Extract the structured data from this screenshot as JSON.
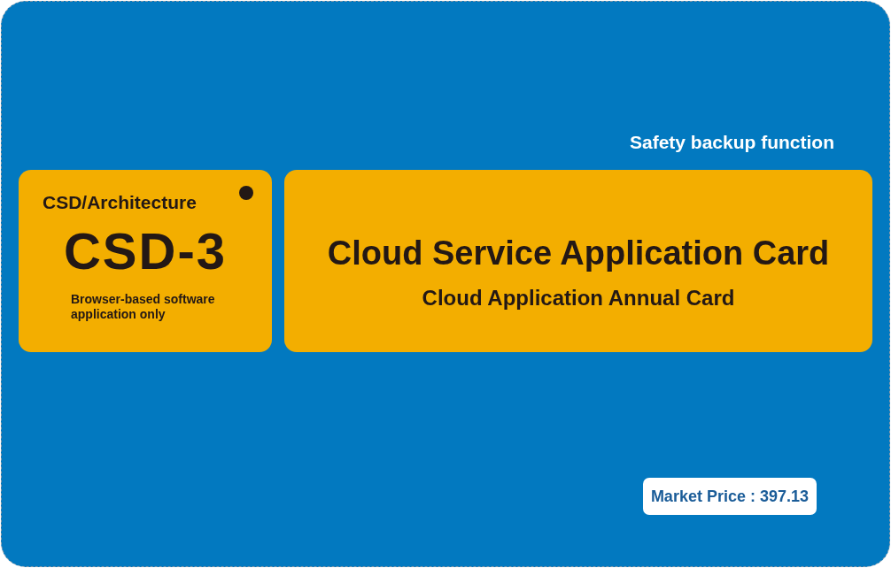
{
  "tagline": "Safety backup function",
  "badge_panel": {
    "category": "CSD/Architecture",
    "code": "CSD-3",
    "note": "Browser-based software application only"
  },
  "title_panel": {
    "title": "Cloud Service Application Card",
    "subtitle": "Cloud Application Annual Card"
  },
  "price": "Market Price : 397.13"
}
